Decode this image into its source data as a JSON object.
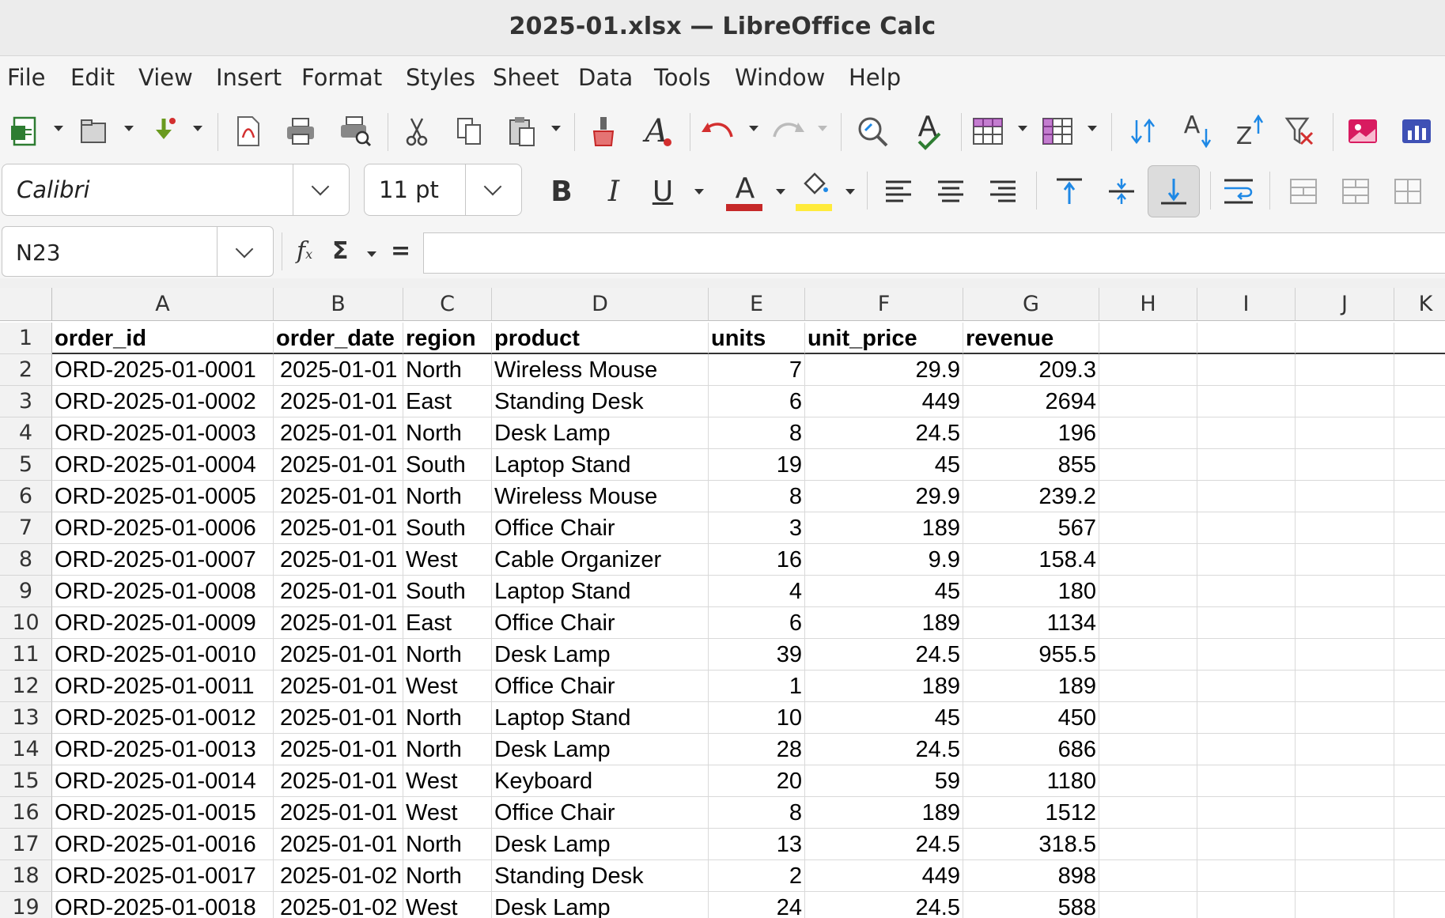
{
  "window": {
    "title": "2025-01.xlsx — LibreOffice Calc"
  },
  "menu": [
    "File",
    "Edit",
    "View",
    "Insert",
    "Format",
    "Styles",
    "Sheet",
    "Data",
    "Tools",
    "Window",
    "Help"
  ],
  "formatting": {
    "font_name": "Calibri",
    "font_size": "11 pt"
  },
  "formula_bar": {
    "cell_ref": "N23",
    "formula": ""
  },
  "columns": [
    "A",
    "B",
    "C",
    "D",
    "E",
    "F",
    "G",
    "H",
    "I",
    "J",
    "K"
  ],
  "rows": [
    [
      "order_id",
      "order_date",
      "region",
      "product",
      "units",
      "unit_price",
      "revenue"
    ],
    [
      "ORD-2025-01-0001",
      "2025-01-01",
      "North",
      "Wireless Mouse",
      "7",
      "29.9",
      "209.3"
    ],
    [
      "ORD-2025-01-0002",
      "2025-01-01",
      "East",
      "Standing Desk",
      "6",
      "449",
      "2694"
    ],
    [
      "ORD-2025-01-0003",
      "2025-01-01",
      "North",
      "Desk Lamp",
      "8",
      "24.5",
      "196"
    ],
    [
      "ORD-2025-01-0004",
      "2025-01-01",
      "South",
      "Laptop Stand",
      "19",
      "45",
      "855"
    ],
    [
      "ORD-2025-01-0005",
      "2025-01-01",
      "North",
      "Wireless Mouse",
      "8",
      "29.9",
      "239.2"
    ],
    [
      "ORD-2025-01-0006",
      "2025-01-01",
      "South",
      "Office Chair",
      "3",
      "189",
      "567"
    ],
    [
      "ORD-2025-01-0007",
      "2025-01-01",
      "West",
      "Cable Organizer",
      "16",
      "9.9",
      "158.4"
    ],
    [
      "ORD-2025-01-0008",
      "2025-01-01",
      "South",
      "Laptop Stand",
      "4",
      "45",
      "180"
    ],
    [
      "ORD-2025-01-0009",
      "2025-01-01",
      "East",
      "Office Chair",
      "6",
      "189",
      "1134"
    ],
    [
      "ORD-2025-01-0010",
      "2025-01-01",
      "North",
      "Desk Lamp",
      "39",
      "24.5",
      "955.5"
    ],
    [
      "ORD-2025-01-0011",
      "2025-01-01",
      "West",
      "Office Chair",
      "1",
      "189",
      "189"
    ],
    [
      "ORD-2025-01-0012",
      "2025-01-01",
      "North",
      "Laptop Stand",
      "10",
      "45",
      "450"
    ],
    [
      "ORD-2025-01-0013",
      "2025-01-01",
      "North",
      "Desk Lamp",
      "28",
      "24.5",
      "686"
    ],
    [
      "ORD-2025-01-0014",
      "2025-01-01",
      "West",
      "Keyboard",
      "20",
      "59",
      "1180"
    ],
    [
      "ORD-2025-01-0015",
      "2025-01-01",
      "West",
      "Office Chair",
      "8",
      "189",
      "1512"
    ],
    [
      "ORD-2025-01-0016",
      "2025-01-01",
      "North",
      "Desk Lamp",
      "13",
      "24.5",
      "318.5"
    ],
    [
      "ORD-2025-01-0017",
      "2025-01-02",
      "North",
      "Standing Desk",
      "2",
      "449",
      "898"
    ],
    [
      "ORD-2025-01-0018",
      "2025-01-02",
      "West",
      "Desk Lamp",
      "24",
      "24.5",
      "588"
    ]
  ]
}
